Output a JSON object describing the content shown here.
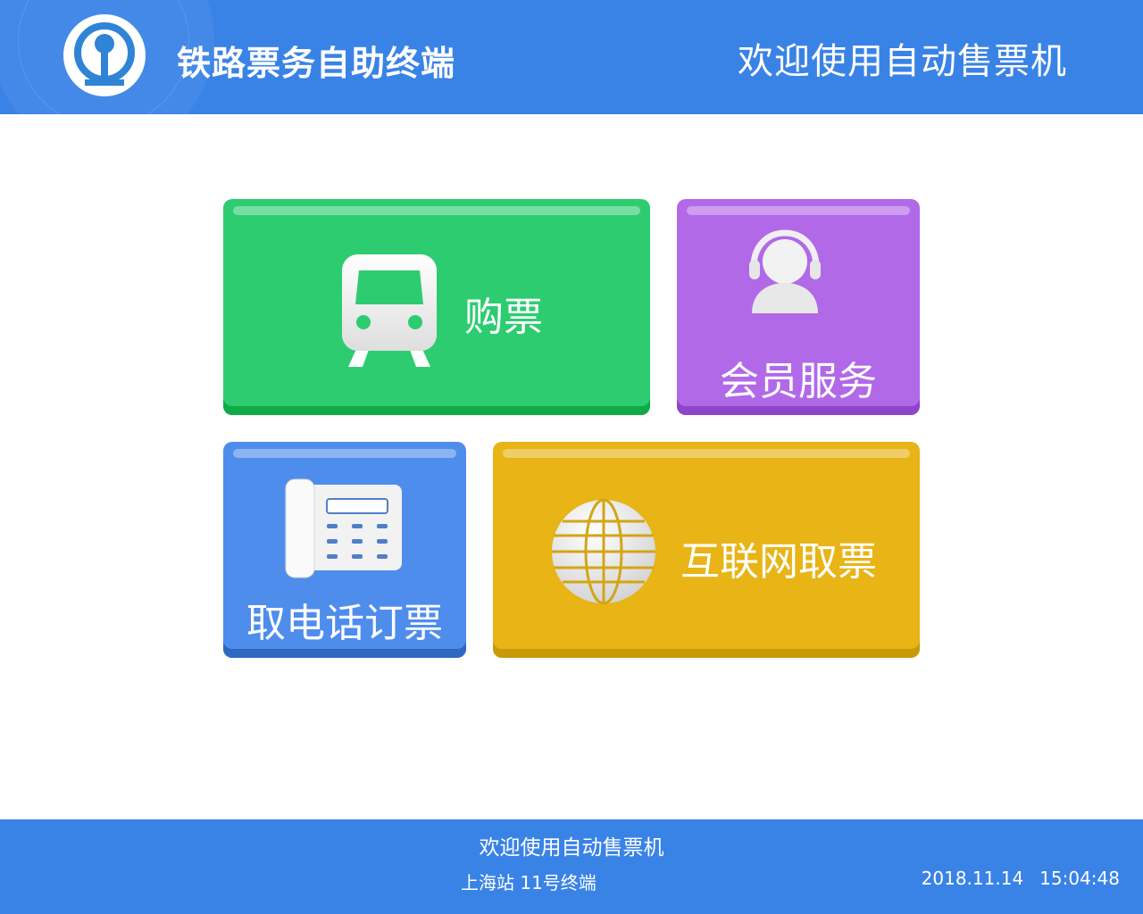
{
  "header": {
    "app_title": "铁路票务自助终端",
    "welcome_title": "欢迎使用自动售票机"
  },
  "tiles": [
    {
      "label": "购票",
      "icon": "train-icon",
      "color": "#2ecc71"
    },
    {
      "label": "会员服务",
      "icon": "customer-service-headset-icon",
      "color": "#b169e8"
    },
    {
      "label": "取电话订票",
      "icon": "telephone-icon",
      "color": "#4f8ded"
    },
    {
      "label": "互联网取票",
      "icon": "globe-icon",
      "color": "#e8b416"
    }
  ],
  "footer": {
    "welcome": "欢迎使用自动售票机",
    "station": "上海站 11号终端",
    "date": "2018.11.14",
    "time": "15:04:48"
  },
  "colors": {
    "header_bg": "#3a83e6",
    "footer_bg": "#3a83e6"
  }
}
